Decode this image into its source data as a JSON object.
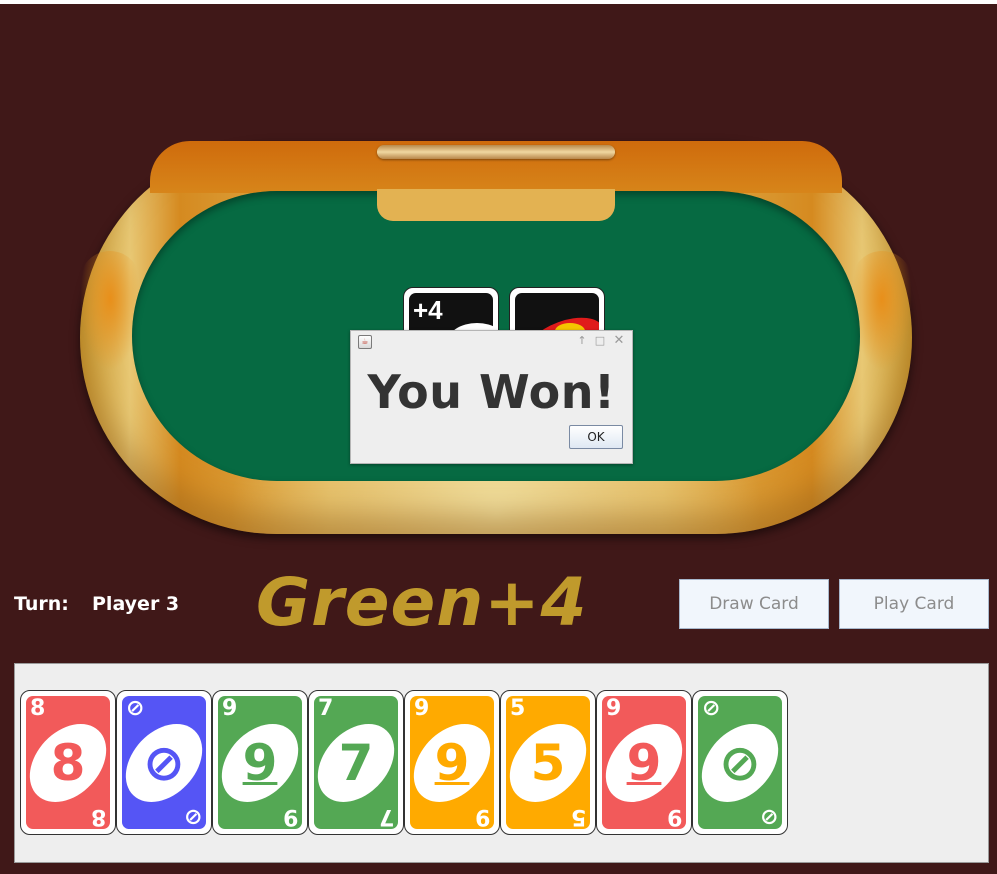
{
  "dialog": {
    "message": "You Won!",
    "ok_label": "OK",
    "icons": [
      "java-icon",
      "arrow-up-icon",
      "maximize-icon",
      "close-icon"
    ]
  },
  "status": {
    "turn_label": "Turn:",
    "turn_player": "Player 3",
    "current_color": "Green+4"
  },
  "actions": {
    "draw_label": "Draw Card",
    "play_label": "Play Card"
  },
  "table": {
    "discard_card": {
      "label": "+4",
      "color": "#111111"
    },
    "deck_card": {
      "color": "#111111"
    }
  },
  "hand": {
    "cards": [
      {
        "color": "red",
        "hex": "#f25a5a",
        "value": "8",
        "corner": "8"
      },
      {
        "color": "blue",
        "hex": "#5555f5",
        "value": "⊘",
        "corner": "⊘"
      },
      {
        "color": "green",
        "hex": "#54a854",
        "value": "9",
        "corner": "9"
      },
      {
        "color": "green",
        "hex": "#54a854",
        "value": "7",
        "corner": "7"
      },
      {
        "color": "yellow",
        "hex": "#ffaa00",
        "value": "9",
        "corner": "9"
      },
      {
        "color": "yellow",
        "hex": "#ffaa00",
        "value": "5",
        "corner": "5"
      },
      {
        "color": "red",
        "hex": "#f25a5a",
        "value": "9",
        "corner": "9"
      },
      {
        "color": "green",
        "hex": "#54a854",
        "value": "⊘",
        "corner": "⊘"
      }
    ]
  },
  "colors": {
    "background": "#401818",
    "felt": "#066a42",
    "current_color_text": "#c09a2c"
  }
}
